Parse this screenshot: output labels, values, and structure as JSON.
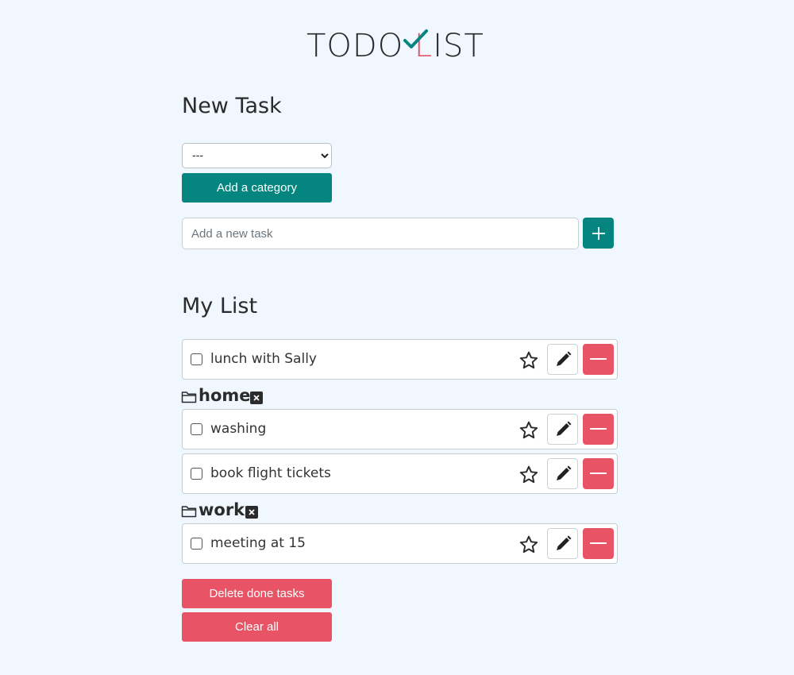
{
  "logo": {
    "text_left": "TODO ",
    "text_accent": "L",
    "text_right": "IST"
  },
  "new_task": {
    "title": "New Task",
    "category_select": {
      "selected": "---",
      "options": [
        "---"
      ]
    },
    "add_category_label": "Add a category",
    "task_input_placeholder": "Add a new task",
    "task_input_value": ""
  },
  "my_list": {
    "title": "My List",
    "uncategorized": [
      {
        "label": "lunch with Sally",
        "done": false,
        "starred": false
      }
    ],
    "categories": [
      {
        "name": "home",
        "tasks": [
          {
            "label": "washing",
            "done": false,
            "starred": false
          },
          {
            "label": "book flight tickets",
            "done": false,
            "starred": false
          }
        ]
      },
      {
        "name": "work",
        "tasks": [
          {
            "label": "meeting at 15",
            "done": false,
            "starred": false
          }
        ]
      }
    ],
    "delete_done_label": "Delete done tasks",
    "clear_all_label": "Clear all"
  },
  "colors": {
    "accent_teal": "#05857f",
    "danger_red": "#e85465",
    "background": "#f0f7fe",
    "logo_accent": "#e05567"
  },
  "icons": {
    "add": "plus-icon",
    "star": "star-outline-icon",
    "edit": "pencil-icon",
    "delete": "minus-icon",
    "category": "folder-icon",
    "remove_category": "close-icon"
  }
}
